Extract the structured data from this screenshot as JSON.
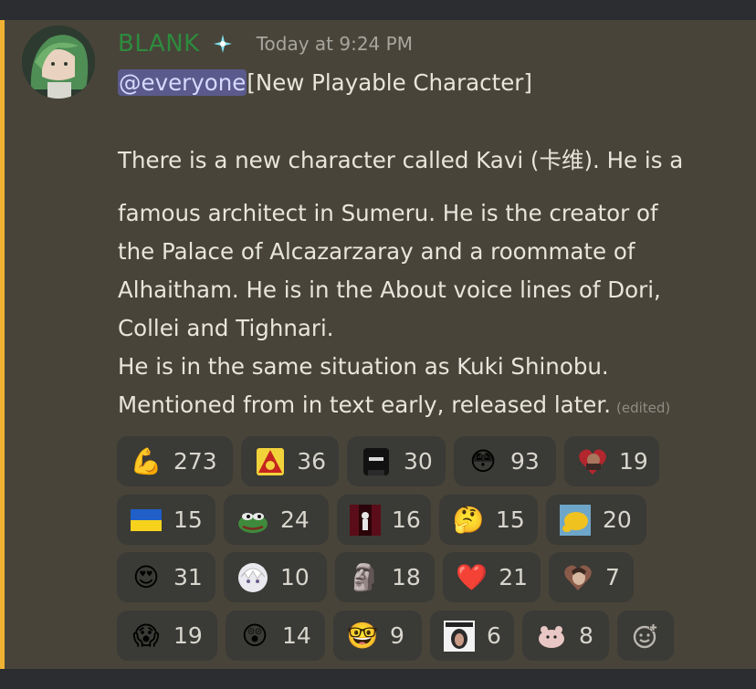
{
  "message": {
    "username": "BLANK",
    "timestamp": "Today at 9:24 PM",
    "mention": "@everyone",
    "lines": [
      "[New Playable Character]",
      "There is a new character called Kavi (卡维). He is a",
      "famous architect in Sumeru. He is the creator of",
      "the Palace of Alcazarzaray and a roommate of",
      "Alhaitham. He is in the About voice lines of Dori,",
      "Collei and Tighnari.",
      "He is in the same situation as Kuki Shinobu.",
      "Mentioned from in text early, released later."
    ],
    "edited_label": "(edited)"
  },
  "reactions": [
    {
      "icon": "flexed-biceps-icon",
      "glyph": "💪",
      "count": "273"
    },
    {
      "icon": "yellow-warning-emblem-icon",
      "glyph": "",
      "count": "36"
    },
    {
      "icon": "dark-hooded-figure-icon",
      "glyph": "",
      "count": "30"
    },
    {
      "icon": "flushed-face-icon",
      "glyph": "😳",
      "count": "93"
    },
    {
      "icon": "heart-portrait-icon",
      "glyph": "",
      "count": "19"
    },
    {
      "icon": "ukraine-flag-icon",
      "glyph": "",
      "count": "15"
    },
    {
      "icon": "pepe-frog-icon",
      "glyph": "",
      "count": "24"
    },
    {
      "icon": "dark-red-figure-icon",
      "glyph": "",
      "count": "16"
    },
    {
      "icon": "thinking-face-icon",
      "glyph": "🤔",
      "count": "15"
    },
    {
      "icon": "yellow-blob-icon",
      "glyph": "",
      "count": "20"
    },
    {
      "icon": "heart-eyes-face-icon",
      "glyph": "😍",
      "count": "31"
    },
    {
      "icon": "white-haired-anime-face-icon",
      "glyph": "",
      "count": "10"
    },
    {
      "icon": "moai-icon",
      "glyph": "🗿",
      "count": "18"
    },
    {
      "icon": "red-heart-icon",
      "glyph": "❤️",
      "count": "21"
    },
    {
      "icon": "heart-photo-icon",
      "glyph": "",
      "count": "7"
    },
    {
      "icon": "screaming-face-icon",
      "glyph": "😱",
      "count": "19"
    },
    {
      "icon": "hushed-face-icon",
      "glyph": "😲",
      "count": "14"
    },
    {
      "icon": "nerd-face-icon",
      "glyph": "🤓",
      "count": "9"
    },
    {
      "icon": "meme-portrait-icon",
      "glyph": "",
      "count": "6"
    },
    {
      "icon": "pink-creature-icon",
      "glyph": "",
      "count": "8"
    }
  ],
  "add_reaction_icon": "add-reaction-icon",
  "colors": {
    "accent": "#f0b232",
    "username": "#2e8b3e",
    "mention_bg": "#5a5a8c",
    "message_bg": "#484439"
  }
}
